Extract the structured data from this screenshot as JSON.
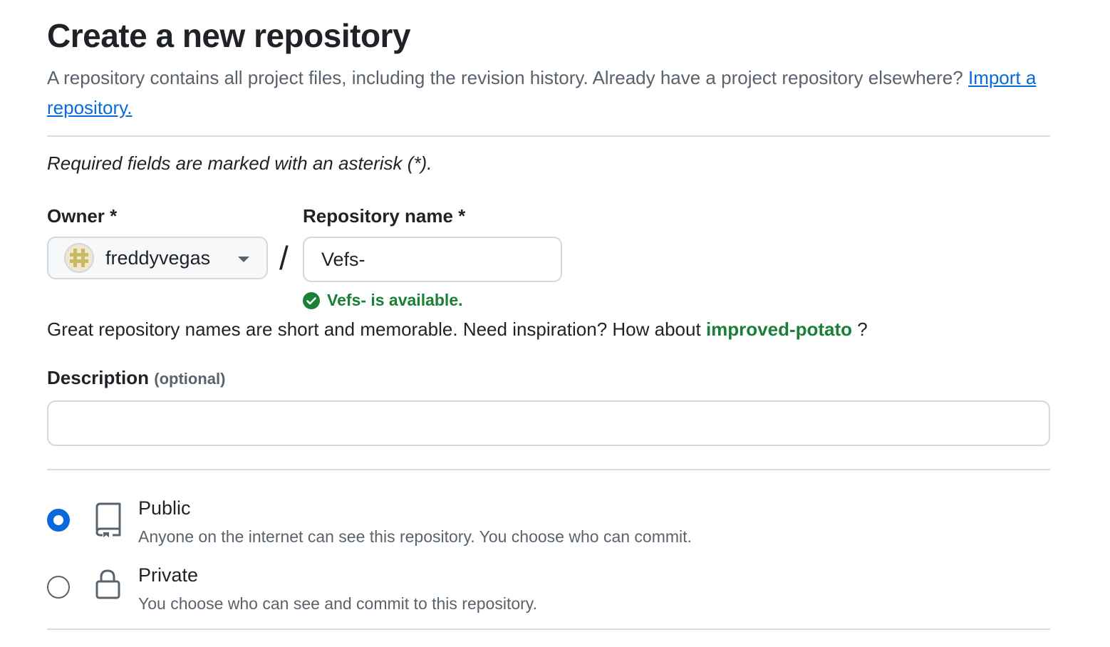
{
  "header": {
    "title": "Create a new repository",
    "intro_text": "A repository contains all project files, including the revision history. Already have a project repository elsewhere?",
    "import_link": "Import a repository."
  },
  "form": {
    "required_note": "Required fields are marked with an asterisk (*).",
    "owner": {
      "label": "Owner *",
      "value": "freddyvegas",
      "avatar_icon": "identicon-avatar"
    },
    "separator": "/",
    "repo_name": {
      "label": "Repository name *",
      "value": "Vefs-",
      "availability": "Vefs- is available.",
      "status_color": "#1a7f37"
    },
    "suggestion": {
      "prefix": "Great repository names are short and memorable. Need inspiration? How about",
      "name": "improved-potato",
      "suffix": "?"
    },
    "description": {
      "label": "Description",
      "optional": "(optional)",
      "value": "",
      "placeholder": ""
    },
    "visibility": {
      "selected": "public",
      "options": [
        {
          "key": "public",
          "title": "Public",
          "description": "Anyone on the internet can see this repository. You choose who can commit.",
          "icon": "repo-icon"
        },
        {
          "key": "private",
          "title": "Private",
          "description": "You choose who can see and commit to this repository.",
          "icon": "lock-icon"
        }
      ]
    }
  },
  "colors": {
    "link": "#0969da",
    "success": "#1a7f37",
    "radio_selected": "#0969da",
    "muted_text": "#59636e",
    "border": "#d1d9e0"
  }
}
